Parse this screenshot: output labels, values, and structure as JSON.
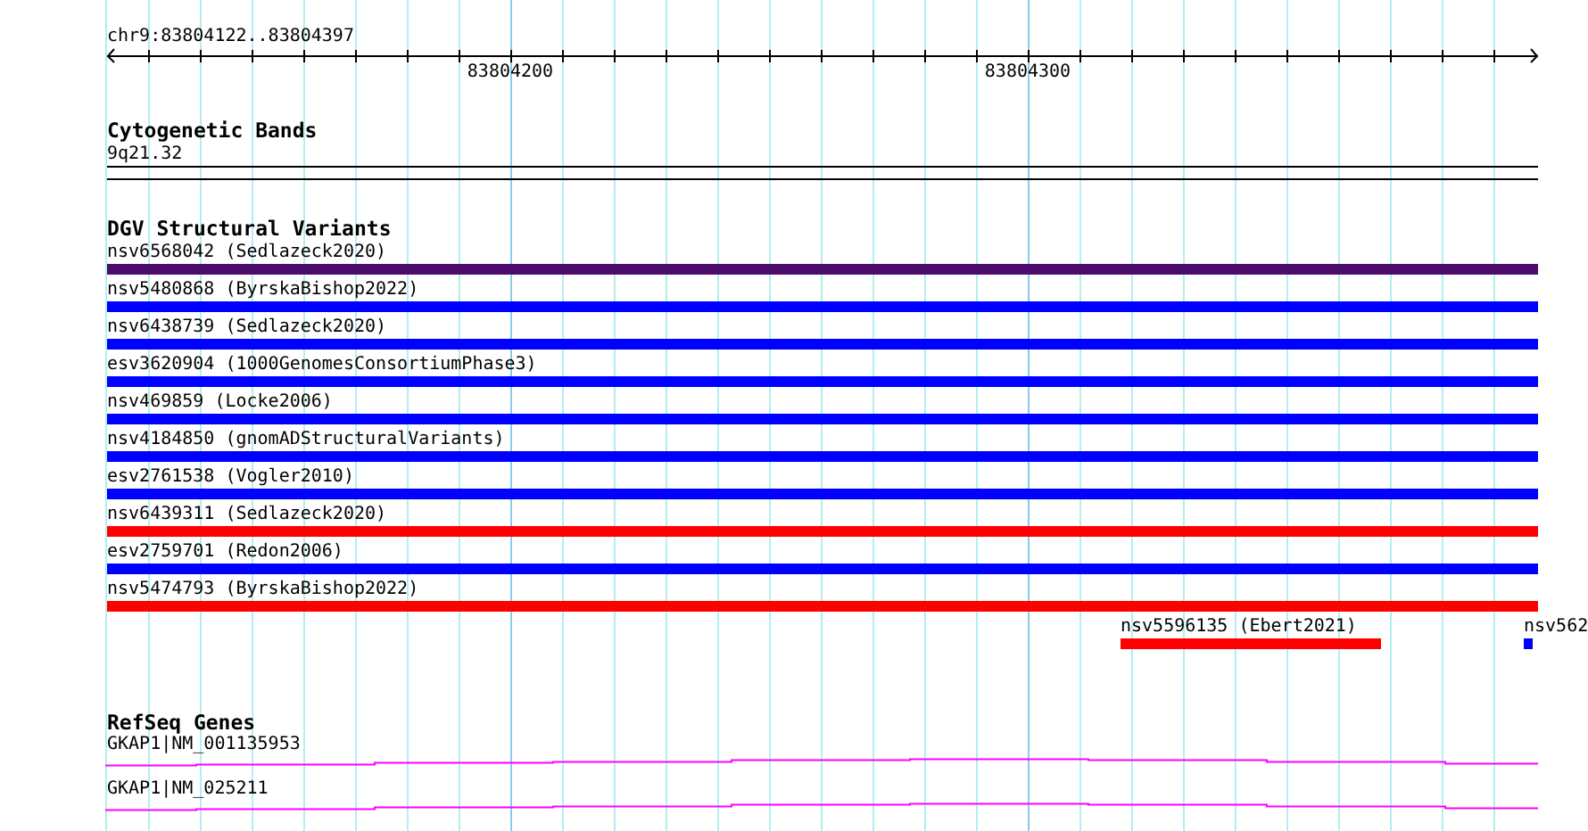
{
  "ruler": {
    "location": "chr9:83804122..83804397",
    "ticks": [
      "83804200",
      "83804300"
    ]
  },
  "tracks": [
    {
      "kind": "cytoband",
      "title": "Cytogenetic Bands",
      "bands": [
        {
          "label": "9q21.32"
        }
      ]
    },
    {
      "kind": "variants",
      "title": "DGV Structural Variants",
      "rows": [
        {
          "features": [
            {
              "label": "nsv6568042 (Sedlazeck2020)",
              "color": "#4b0c6e"
            }
          ]
        },
        {
          "features": [
            {
              "label": "nsv5480868 (ByrskaBishop2022)",
              "color": "#0000ff"
            }
          ]
        },
        {
          "features": [
            {
              "label": "nsv6438739 (Sedlazeck2020)",
              "color": "#0000ff"
            }
          ]
        },
        {
          "features": [
            {
              "label": "esv3620904 (1000GenomesConsortiumPhase3)",
              "color": "#0000ff"
            }
          ]
        },
        {
          "features": [
            {
              "label": "nsv469859 (Locke2006)",
              "color": "#0000ff"
            }
          ]
        },
        {
          "features": [
            {
              "label": "nsv4184850 (gnomADStructuralVariants)",
              "color": "#0000ff"
            }
          ]
        },
        {
          "features": [
            {
              "label": "esv2761538 (Vogler2010)",
              "color": "#0000ff"
            }
          ]
        },
        {
          "features": [
            {
              "label": "nsv6439311 (Sedlazeck2020)",
              "color": "#ff0000"
            }
          ]
        },
        {
          "features": [
            {
              "label": "esv2759701 (Redon2006)",
              "color": "#0000ff"
            }
          ]
        },
        {
          "features": [
            {
              "label": "nsv5474793 (ByrskaBishop2022)",
              "color": "#ff0000"
            }
          ]
        },
        {
          "features": [
            {
              "label": "nsv5596135 (Ebert2021)",
              "color": "#ff0000"
            },
            {
              "label": "nsv562",
              "color": "#0000ff"
            }
          ]
        }
      ]
    },
    {
      "kind": "genes",
      "title": "RefSeq Genes",
      "genes": [
        {
          "label": "GKAP1|NM_001135953"
        },
        {
          "label": "GKAP1|NM_025211"
        }
      ]
    }
  ]
}
